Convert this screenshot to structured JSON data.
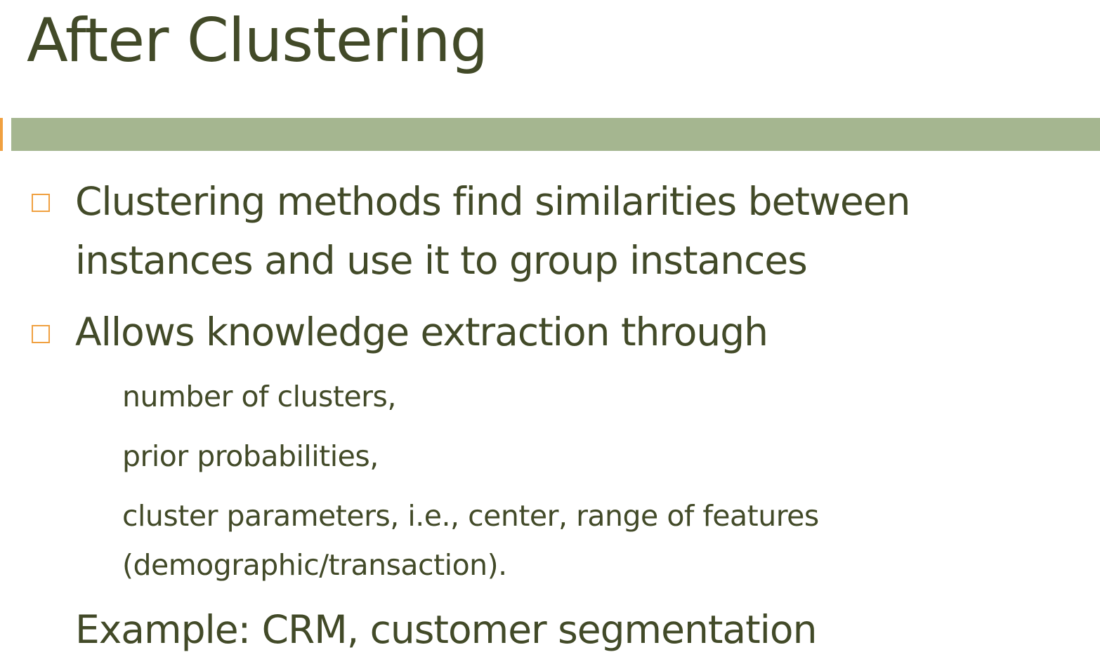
{
  "slide": {
    "title": "After Clustering",
    "bullets": [
      {
        "lines": [
          "Clustering methods find similarities between",
          "instances and use it to group instances"
        ]
      },
      {
        "lines": [
          "Allows knowledge extraction through"
        ]
      }
    ],
    "sub_items": [
      "number of clusters,",
      "prior probabilities,",
      "cluster parameters, i.e., center, range of features",
      "(demographic/transaction)."
    ],
    "example": "Example: CRM, customer segmentation"
  },
  "colors": {
    "text": "#424a28",
    "band": "#a5b690",
    "accent": "#f0a040"
  },
  "icons": {
    "bullet": "hollow-square-bullet-icon"
  }
}
